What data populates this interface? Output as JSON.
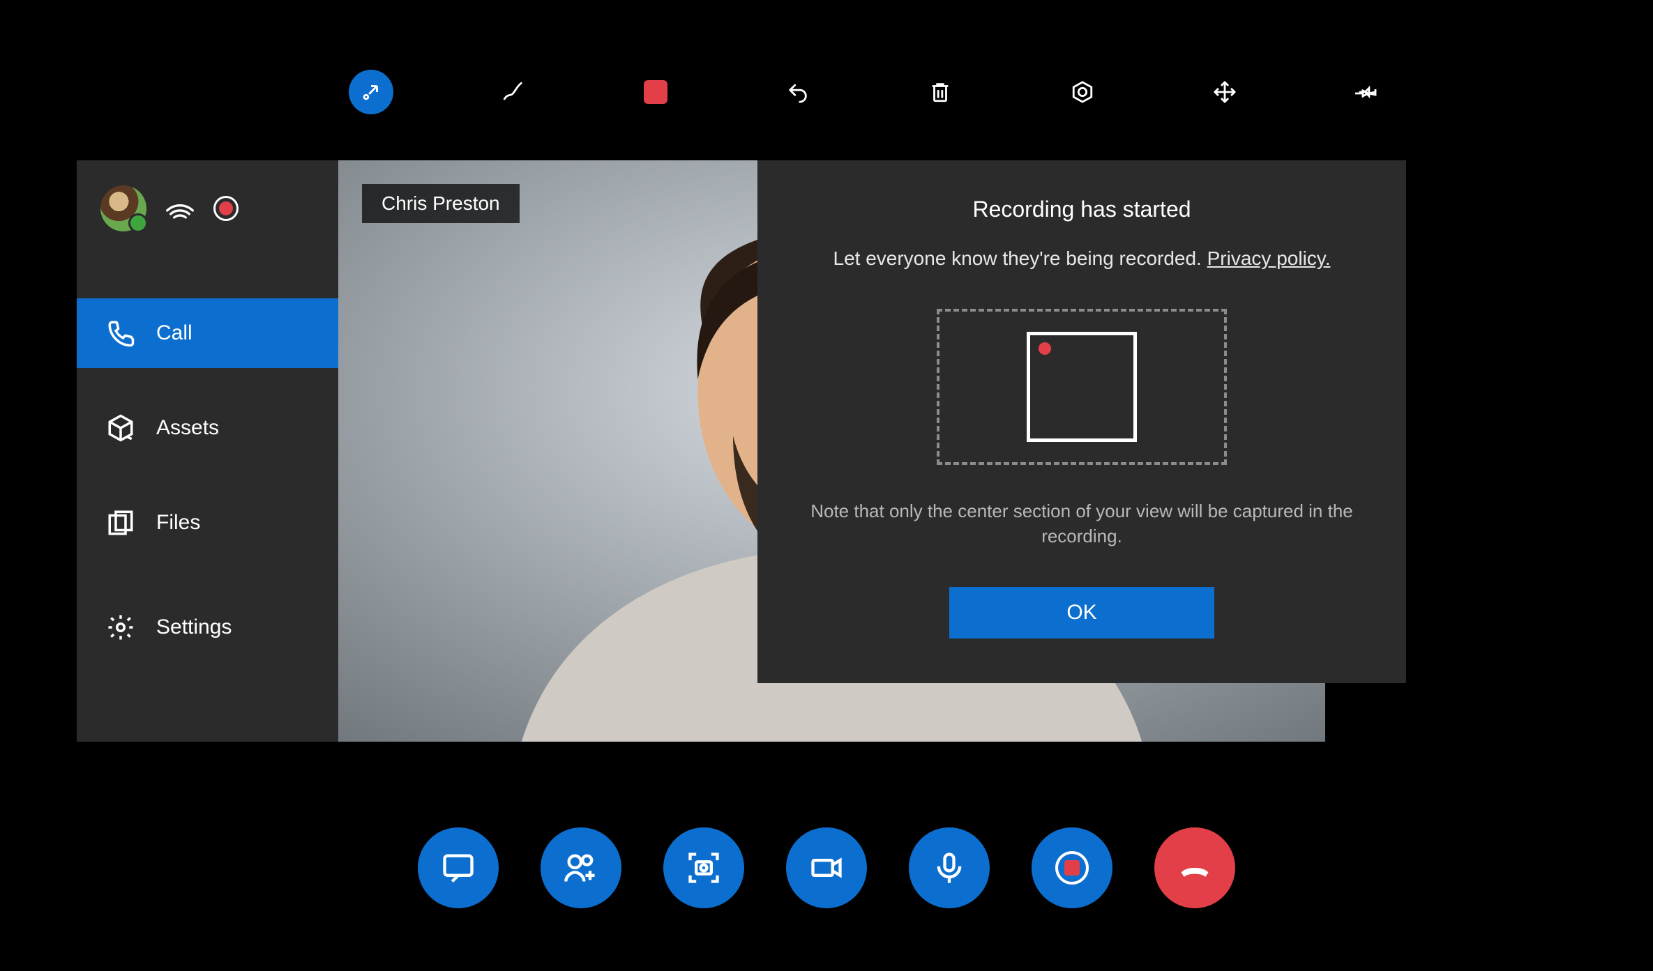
{
  "colors": {
    "accent": "#0c6fcf",
    "danger": "#e23f48",
    "panel": "#2b2b2b"
  },
  "toolbar_top": {
    "items": [
      {
        "name": "collapse-icon",
        "active": true
      },
      {
        "name": "ink-icon"
      },
      {
        "name": "stop-record-icon"
      },
      {
        "name": "undo-icon"
      },
      {
        "name": "trash-icon"
      },
      {
        "name": "target-icon"
      },
      {
        "name": "move-icon"
      },
      {
        "name": "pin-icon"
      }
    ]
  },
  "sidebar": {
    "status": "available",
    "items": [
      {
        "key": "call",
        "label": "Call",
        "active": true
      },
      {
        "key": "assets",
        "label": "Assets"
      },
      {
        "key": "files",
        "label": "Files"
      },
      {
        "key": "settings",
        "label": "Settings"
      }
    ]
  },
  "video": {
    "participant_name": "Chris Preston"
  },
  "dialog": {
    "title": "Recording has started",
    "message_prefix": "Let everyone know they're being recorded. ",
    "privacy_link_text": "Privacy policy.",
    "note": "Note that only the center section of your view will be captured in the recording.",
    "ok_label": "OK"
  },
  "bottom_controls": {
    "items": [
      {
        "name": "chat-button"
      },
      {
        "name": "add-people-button"
      },
      {
        "name": "camera-capture-button"
      },
      {
        "name": "video-toggle-button"
      },
      {
        "name": "microphone-toggle-button"
      },
      {
        "name": "record-toggle-button"
      },
      {
        "name": "end-call-button"
      }
    ]
  }
}
